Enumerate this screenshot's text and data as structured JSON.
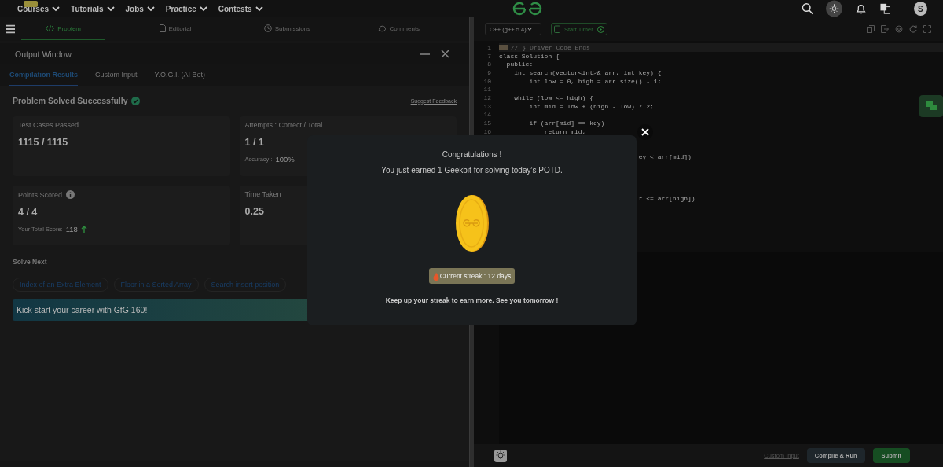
{
  "nav": {
    "items": [
      {
        "label": "Courses",
        "badge": true
      },
      {
        "label": "Tutorials",
        "badge": false
      },
      {
        "label": "Jobs",
        "badge": false
      },
      {
        "label": "Practice",
        "badge": false
      },
      {
        "label": "Contests",
        "badge": false
      }
    ],
    "avatar": "S"
  },
  "problem_tabs": [
    {
      "label": "Problem",
      "selected": true
    },
    {
      "label": "Editorial",
      "selected": false
    },
    {
      "label": "Submissions",
      "selected": false
    },
    {
      "label": "Comments",
      "selected": false
    }
  ],
  "output_window": {
    "title": "Output Window",
    "tabs": [
      {
        "label": "Compilation Results",
        "selected": true
      },
      {
        "label": "Custom Input",
        "selected": false
      },
      {
        "label": "Y.O.G.I. (AI Bot)",
        "selected": false
      }
    ],
    "status": "Problem Solved Successfully",
    "feedback": "Suggest Feedback",
    "cards": [
      {
        "kind": "plain",
        "label": "Test Cases Passed",
        "value": "1115 / 1115",
        "info": false
      },
      {
        "kind": "detail",
        "label": "Attempts : Correct / Total",
        "value": "1 / 1",
        "info": false,
        "detail_label": "Accuracy :",
        "detail_value": "100%"
      },
      {
        "kind": "score",
        "label": "Points Scored",
        "value": "4 / 4",
        "info": true,
        "detail_label": "Your Total Score:",
        "detail_value": "118"
      },
      {
        "kind": "plain",
        "label": "Time Taken",
        "value": "0.25",
        "info": false
      }
    ],
    "solve_next": {
      "title": "Solve Next",
      "chips": [
        "Index of an Extra Element",
        "Floor in a Sorted Array",
        "Search insert position"
      ]
    },
    "banner": "Kick start your career with GfG 160!"
  },
  "editor": {
    "language": "C++ (g++ 5.4)",
    "timer": "Start Timer",
    "lines": [
      {
        "number": "1",
        "text": "// } Driver Code Ends",
        "kind": "comment"
      },
      {
        "number": "7",
        "text": "class Solution {",
        "kind": "code"
      },
      {
        "number": "8",
        "text": "  public:",
        "kind": "code"
      },
      {
        "number": "9",
        "text": "    int search(vector<int>& arr, int key) {",
        "kind": "code"
      },
      {
        "number": "10",
        "text": "        int low = 0, high = arr.size() - 1;",
        "kind": "code"
      },
      {
        "number": "11",
        "kind": "blank"
      },
      {
        "number": "12",
        "text": "    while (low <= high) {",
        "kind": "code"
      },
      {
        "number": "13",
        "text": "        int mid = low + (high - low) / 2;",
        "kind": "code"
      },
      {
        "number": "14",
        "kind": "blank"
      },
      {
        "number": "15",
        "text": "        if (arr[mid] == key)",
        "kind": "code"
      },
      {
        "number": "16",
        "text": "            return mid;",
        "kind": "code"
      },
      {
        "kind": "blank"
      },
      {
        "kind": "blank"
      },
      {
        "text": "ey < arr[mid])",
        "kind": "tail"
      },
      {
        "kind": "blank"
      },
      {
        "kind": "blank"
      },
      {
        "kind": "blank"
      },
      {
        "kind": "blank"
      },
      {
        "text": "r <= arr[high])",
        "kind": "tail"
      }
    ],
    "custom_input": "Custom Input",
    "run": "Compile & Run",
    "submit": "Submit"
  },
  "modal": {
    "title": "Congratulations !",
    "message": "You just earned 1 Geekbit for solving today’s POTD.",
    "streak": "Current streak : 12 days",
    "footer": "Keep up your streak to earn more. See you tomorrow !"
  }
}
